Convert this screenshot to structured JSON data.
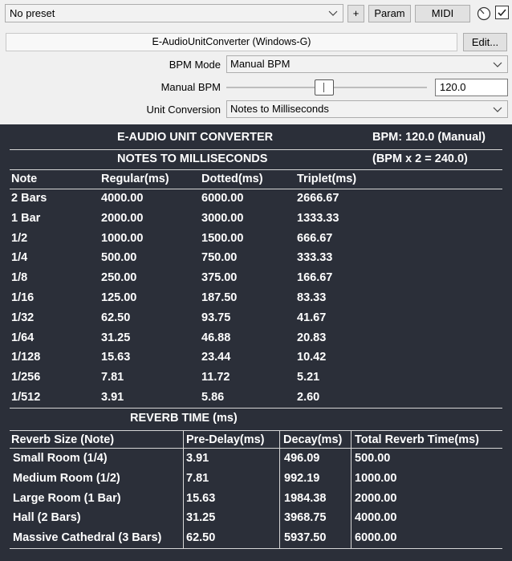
{
  "host": {
    "preset_value": "No preset",
    "plus_label": "+",
    "param_label": "Param",
    "midi_label": "MIDI",
    "plugin_name": "E-AudioUnitConverter (Windows-G)",
    "edit_label": "Edit..."
  },
  "params": {
    "bpm_mode_label": "BPM Mode",
    "bpm_mode_value": "Manual BPM",
    "manual_bpm_label": "Manual BPM",
    "manual_bpm_value": "120.0",
    "unit_conversion_label": "Unit Conversion",
    "unit_conversion_value": "Notes to Milliseconds"
  },
  "display": {
    "title": "E-AUDIO UNIT CONVERTER",
    "bpm_status": "BPM: 120.0 (Manual)",
    "mode_title": "NOTES TO MILLISECONDS",
    "bpm_formula": "(BPM x 2 = 240.0)",
    "notes_headers": [
      "Note",
      "Regular(ms)",
      "Dotted(ms)",
      "Triplet(ms)"
    ],
    "notes_rows": [
      [
        "2 Bars",
        "4000.00",
        "6000.00",
        "2666.67"
      ],
      [
        "1 Bar",
        "2000.00",
        "3000.00",
        "1333.33"
      ],
      [
        "1/2",
        "1000.00",
        "1500.00",
        "666.67"
      ],
      [
        "1/4",
        "500.00",
        "750.00",
        "333.33"
      ],
      [
        "1/8",
        "250.00",
        "375.00",
        "166.67"
      ],
      [
        "1/16",
        "125.00",
        "187.50",
        "83.33"
      ],
      [
        "1/32",
        "62.50",
        "93.75",
        "41.67"
      ],
      [
        "1/64",
        "31.25",
        "46.88",
        "20.83"
      ],
      [
        "1/128",
        "15.63",
        "23.44",
        "10.42"
      ],
      [
        "1/256",
        "7.81",
        "11.72",
        "5.21"
      ],
      [
        "1/512",
        "3.91",
        "5.86",
        "2.60"
      ]
    ],
    "reverb_title": "REVERB TIME (ms)",
    "reverb_headers": [
      "Reverb Size (Note)",
      "Pre-Delay(ms)",
      "Decay(ms)",
      "Total Reverb Time(ms)"
    ],
    "reverb_rows": [
      [
        "Small Room (1/4)",
        "3.91",
        "496.09",
        "500.00"
      ],
      [
        "Medium Room (1/2)",
        "7.81",
        "992.19",
        "1000.00"
      ],
      [
        "Large Room (1 Bar)",
        "15.63",
        "1984.38",
        "2000.00"
      ],
      [
        "Hall (2 Bars)",
        "31.25",
        "3968.75",
        "4000.00"
      ],
      [
        "Massive Cathedral (3 Bars)",
        "62.50",
        "5937.50",
        "6000.00"
      ]
    ]
  }
}
